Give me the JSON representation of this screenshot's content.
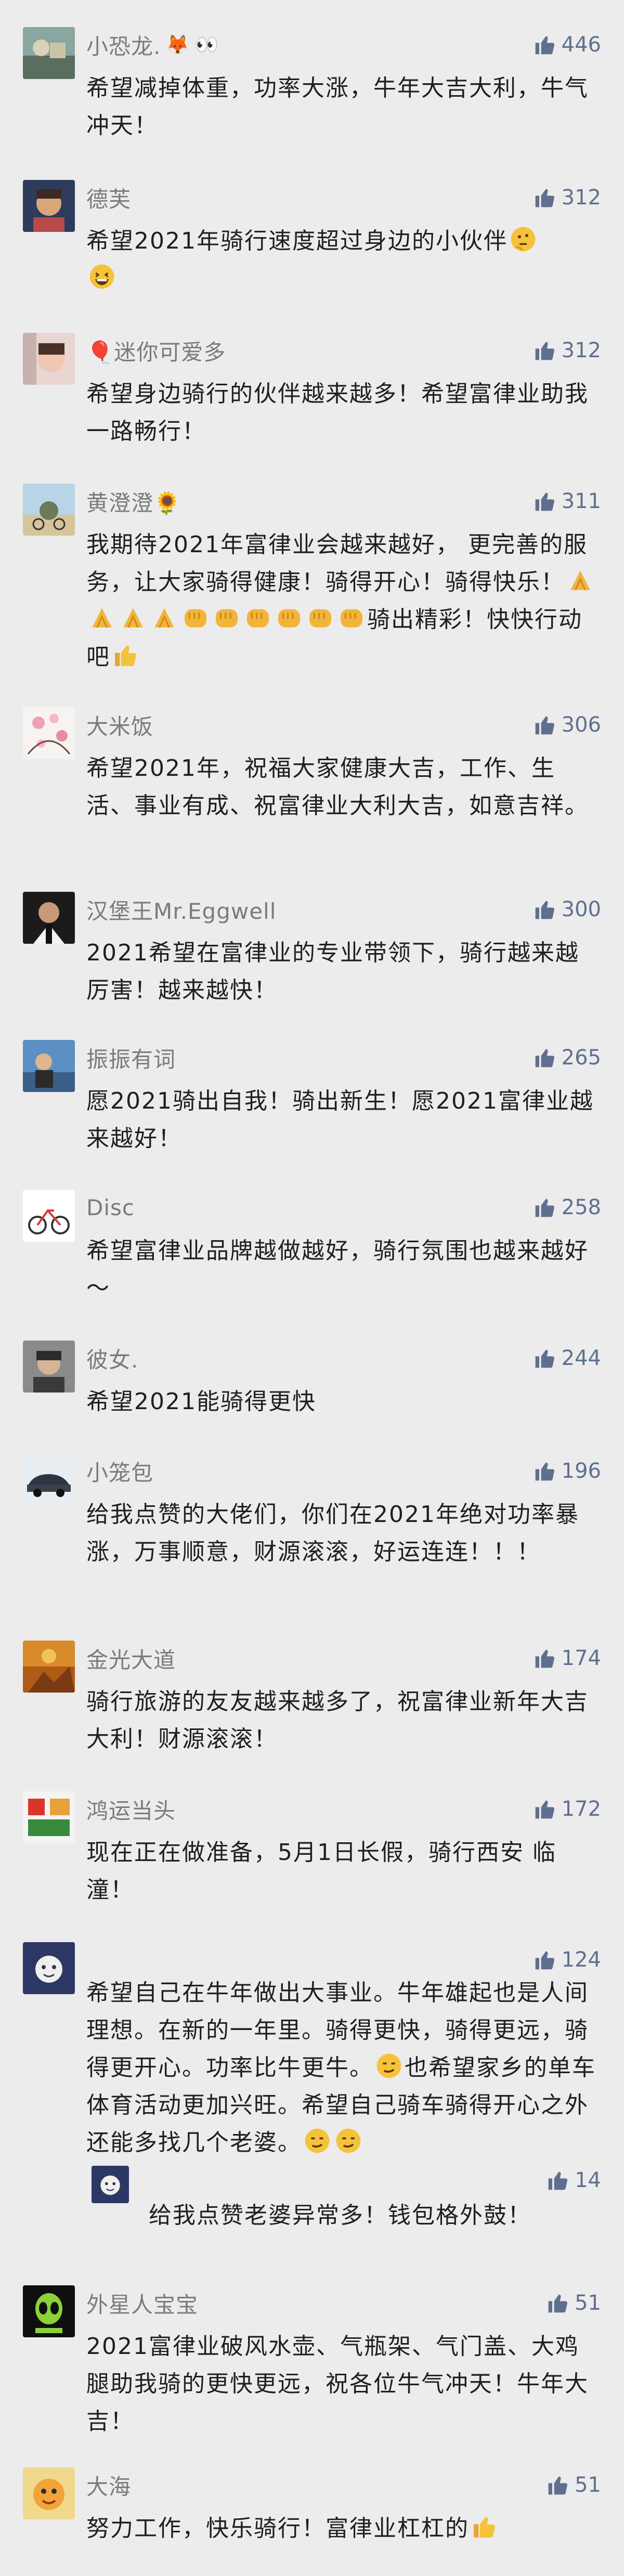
{
  "comments": [
    {
      "name": "小恐龙.",
      "name_emoji": "🦊 👀",
      "likes": "446",
      "text": "希望减掉体重，功率大涨，牛年大吉大利，牛气冲天！"
    },
    {
      "name": "德芙",
      "likes": "312",
      "text": "希望2021年骑行速度超过身边的小伙伴"
    },
    {
      "name": "🎈迷你可爱多",
      "likes": "312",
      "text": "希望身边骑行的伙伴越来越多！希望富律业助我一路畅行！"
    },
    {
      "name": "黄澄澄🌻",
      "likes": "311",
      "text_a": "我期待2021年富律业会越来越好， 更完善的服务，让大家骑得健康！骑得开心！骑得快乐！",
      "text_b": "骑出精彩！快快行动吧"
    },
    {
      "name": "大米饭",
      "likes": "306",
      "text": "希望2021年，祝福大家健康大吉，工作、生活、事业有成、祝富律业大利大吉，如意吉祥。"
    },
    {
      "name": "汉堡王Mr.Eggwell",
      "likes": "300",
      "text": "2021希望在富律业的专业带领下，骑行越来越厉害！越来越快！"
    },
    {
      "name": "振振有词",
      "likes": "265",
      "text": "愿2021骑出自我！骑出新生！愿2021富律业越来越好！"
    },
    {
      "name": "Disc",
      "likes": "258",
      "text": "希望富律业品牌越做越好，骑行氛围也越来越好～"
    },
    {
      "name": "彼女.",
      "likes": "244",
      "text": "希望2021能骑得更快"
    },
    {
      "name": "小笼包",
      "likes": "196",
      "text": "给我点赞的大佬们，你们在2021年绝对功率暴涨，万事顺意，财源滚滚，好运连连！！！"
    },
    {
      "name": "金光大道",
      "likes": "174",
      "text": "骑行旅游的友友越来越多了，祝富律业新年大吉大利！财源滚滚！"
    },
    {
      "name": "鸿运当头",
      "likes": "172",
      "text": "现在正在做准备，5月1日长假，骑行西安 临潼！"
    },
    {
      "name": "",
      "likes": "124",
      "text_a": "希望自己在牛年做出大事业。牛年雄起也是人间理想。在新的一年里。骑得更快，骑得更远，骑得更开心。功率比牛更牛。",
      "text_b": "也希望家乡的单车体育活动更加兴旺。希望自己骑车骑得开心之外还能多找几个老婆。",
      "reply": {
        "likes": "14",
        "text": "给我点赞老婆异常多！钱包格外鼓！"
      }
    },
    {
      "name": "外星人宝宝",
      "likes": "51",
      "text": "2021富律业破风水壶、气瓶架、气门盖、大鸡腿助我骑的更快更远，祝各位牛气冲天！牛年大吉！"
    },
    {
      "name": "大海",
      "likes": "51",
      "text": "努力工作，快乐骑行！富律业杠杠的"
    }
  ]
}
